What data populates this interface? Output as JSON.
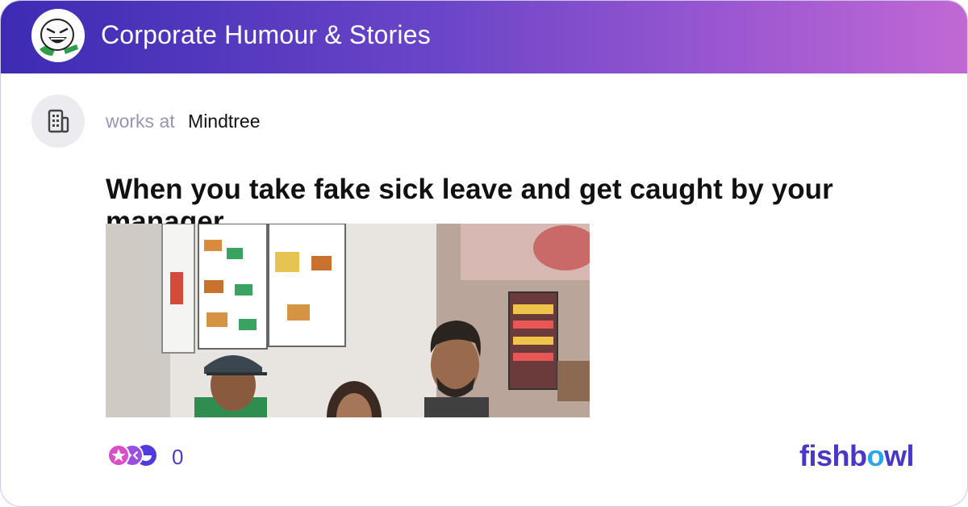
{
  "header": {
    "community_title": "Corporate Humour & Stories",
    "bowl_icon": "laughing-face-icon"
  },
  "author": {
    "avatar_icon": "building-icon",
    "works_at_label": "works at",
    "company": "Mindtree"
  },
  "post": {
    "title": "When you take fake sick leave and get caught by your manager....",
    "image_description": "photo in fast-food restaurant"
  },
  "reactions": {
    "icon": "reaction-bubbles-icon",
    "count": "0"
  },
  "brand": {
    "logo_text": "fishbowl",
    "accent": "#4838c8",
    "accent_secondary": "#2aa7e8"
  },
  "colors": {
    "header_gradient_start": "#3d2bb4",
    "header_gradient_end": "#c069d4"
  }
}
